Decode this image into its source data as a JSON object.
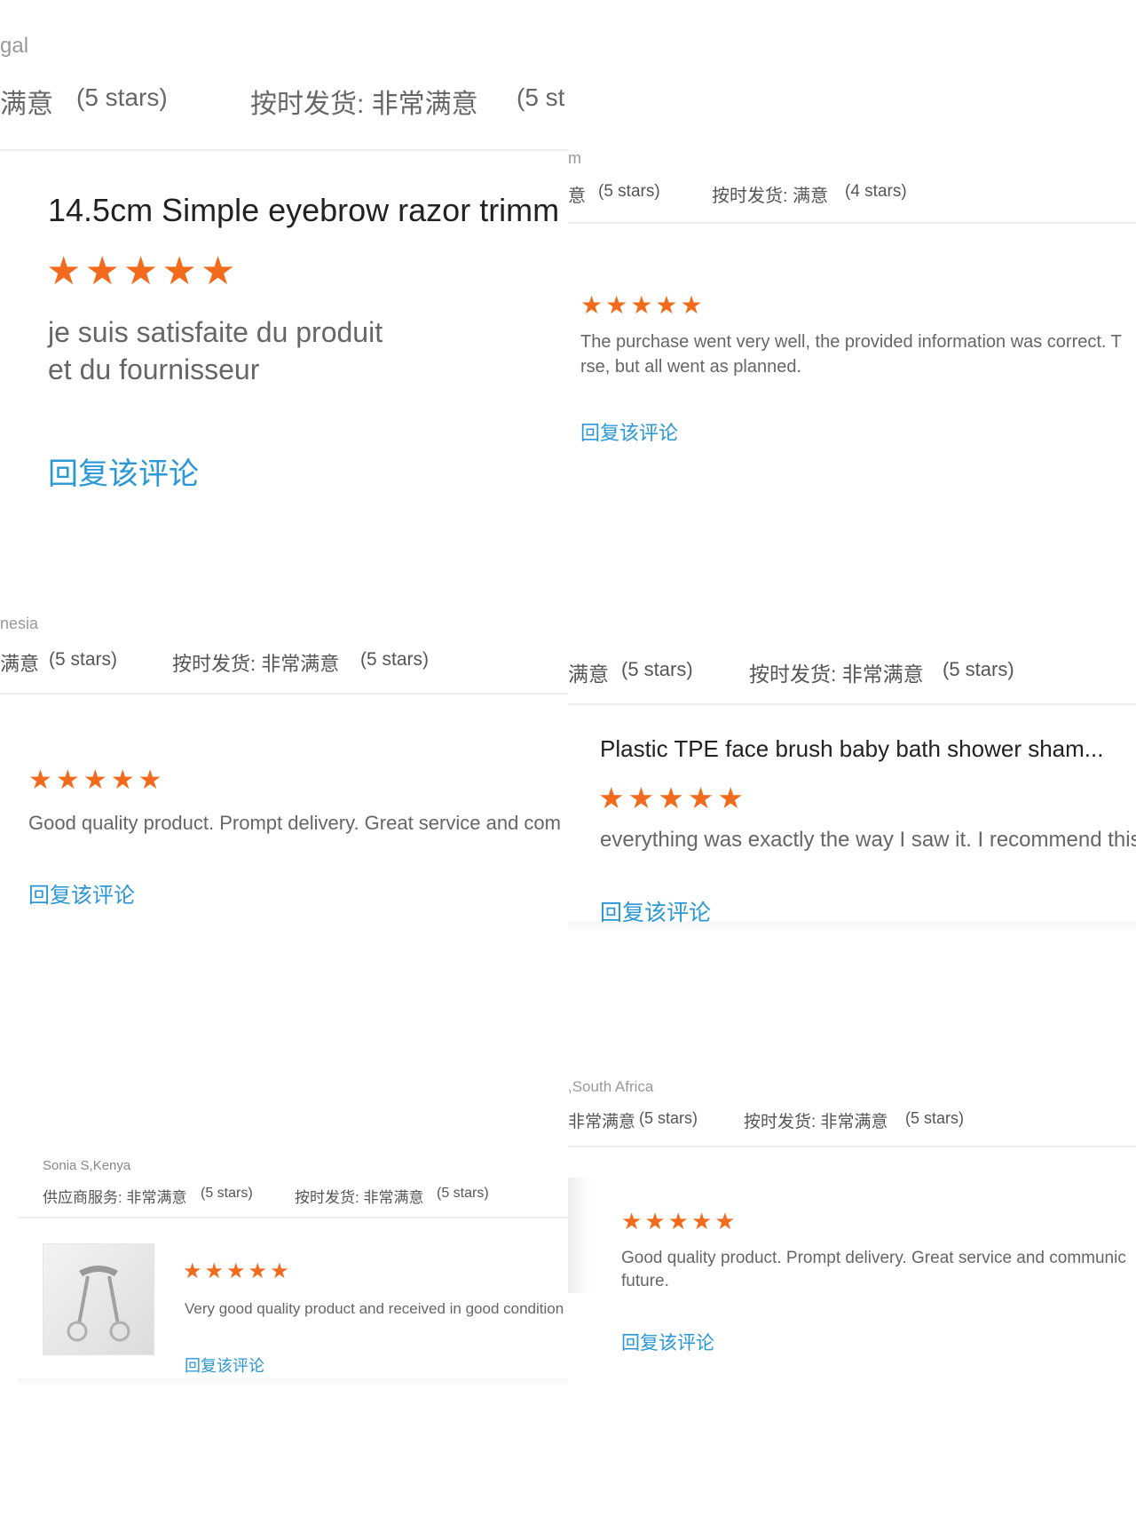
{
  "colors": {
    "star": "#f26b1d",
    "link": "#2a97d6",
    "text": "#555555",
    "meta": "#888888"
  },
  "star_icon": "star-icon",
  "panels": {
    "p1": {
      "country": "gal",
      "rating_left": "满意",
      "rating_left_stars": "(5 stars)",
      "rating_right": "按时发货: 非常满意",
      "rating_right_stars": "(5 st",
      "title": "14.5cm Simple eyebrow razor trimm",
      "rating": 5,
      "text_line1": "je suis satisfaite du produit",
      "text_line2": "et du fournisseur",
      "reply": "回复该评论"
    },
    "p2": {
      "country": "m",
      "rating_left": "意",
      "rating_left_stars": "(5 stars)",
      "rating_right": "按时发货: 满意",
      "rating_right_stars": "(4 stars)",
      "rating": 5,
      "text_line1": "The purchase went very well, the provided information was correct. T",
      "text_line2": "rse, but all went as planned.",
      "reply": "回复该评论"
    },
    "p3": {
      "country": "nesia",
      "rating_left": "满意",
      "rating_left_stars": "(5 stars)",
      "rating_right": "按时发货: 非常满意",
      "rating_right_stars": "(5 stars)",
      "rating": 5,
      "text_line1": "Good quality product. Prompt delivery. Great service and com",
      "reply": "回复该评论"
    },
    "p4": {
      "rating_left": "满意",
      "rating_left_stars": "(5 stars)",
      "rating_right": "按时发货: 非常满意",
      "rating_right_stars": "(5 stars)",
      "title": "Plastic TPE face brush baby bath shower sham...",
      "rating": 5,
      "text_line1": "everything was exactly the way I saw it. I recommend this",
      "reply": "回复该评论"
    },
    "p5": {
      "reviewer": "Sonia S,Kenya",
      "rating_left": "供应商服务: 非常满意",
      "rating_left_stars": "(5 stars)",
      "rating_right": "按时发货: 非常满意",
      "rating_right_stars": "(5 stars)",
      "rating": 5,
      "text_line1": "Very good quality product and received in good condition",
      "reply": "回复该评论"
    },
    "p6": {
      "country": ",South Africa",
      "rating_left": "非常满意",
      "rating_left_stars": "(5 stars)",
      "rating_right": "按时发货: 非常满意",
      "rating_right_stars": "(5 stars)",
      "rating": 5,
      "text_line1": "Good quality product. Prompt delivery. Great service and communic",
      "text_line2": "future.",
      "reply": "回复该评论"
    }
  }
}
